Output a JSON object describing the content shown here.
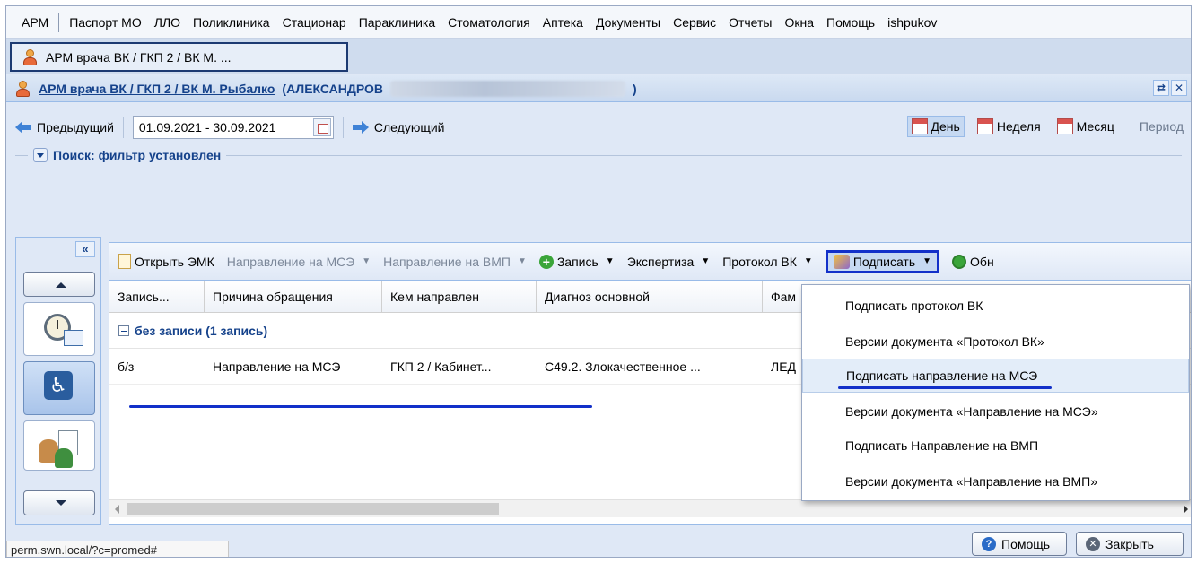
{
  "menu": [
    "АРМ",
    "Паспорт МО",
    "ЛЛО",
    "Поликлиника",
    "Стационар",
    "Параклиника",
    "Стоматология",
    "Аптека",
    "Документы",
    "Сервис",
    "Отчеты",
    "Окна",
    "Помощь",
    "ishpukov"
  ],
  "tab": {
    "label": "АРМ врача ВК / ГКП 2 / ВК М. ..."
  },
  "title": {
    "link": "АРМ врача ВК / ГКП 2 / ВК М. Рыбалко",
    "patient_open": "(АЛЕКСАНДРОВ",
    "patient_close": ")"
  },
  "nav": {
    "prev": "Предыдущий",
    "date_range": "01.09.2021 - 30.09.2021",
    "next": "Следующий"
  },
  "period": {
    "day": "День",
    "week": "Неделя",
    "month": "Месяц",
    "period": "Период"
  },
  "search": {
    "label": "Поиск: фильтр установлен"
  },
  "toolbar": {
    "open_emk": "Открыть ЭМК",
    "mse": "Направление на МСЭ",
    "vmp": "Направление на ВМП",
    "record": "Запись",
    "expertise": "Экспертиза",
    "protocol": "Протокол ВК",
    "sign": "Подписать",
    "refresh": "Обн"
  },
  "columns": [
    "Запись...",
    "Причина обращения",
    "Кем направлен",
    "Диагноз основной",
    "Фам"
  ],
  "group": {
    "label": "без записи (1 запись)"
  },
  "row": [
    "б/з",
    "Направление на МСЭ",
    "ГКП 2 / Кабинет...",
    "C49.2. Злокачественное ...",
    "ЛЕД"
  ],
  "dropdown": [
    "Подписать протокол ВК",
    "Версии документа «Протокол ВК»",
    "Подписать направление на МСЭ",
    "Версии документа «Направление на МСЭ»",
    "Подписать Направление на ВМП",
    "Версии документа «Направление на ВМП»"
  ],
  "status": {
    "url": "perm.swn.local/?c=promed#"
  },
  "footer": {
    "help": "Помощь",
    "close": "Закрыть"
  },
  "colors": {
    "accent": "#15428b",
    "highlight_border": "#1230c9",
    "panel_bg": "#dfe8f6"
  }
}
